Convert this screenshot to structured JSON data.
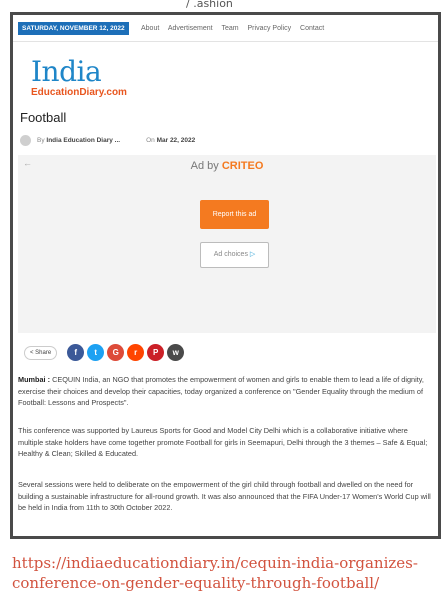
{
  "cutoff_text": "/ .ashion",
  "topbar": {
    "date": "SATURDAY, NOVEMBER 12, 2022",
    "nav": [
      "About",
      "Advertisement",
      "Team",
      "Privacy Policy",
      "Contact"
    ]
  },
  "logo": {
    "main": "India",
    "sub": "EducationDiary.com"
  },
  "article": {
    "title": "Football",
    "by_prefix": "By",
    "author": "India Education Diary ...",
    "on_prefix": "On",
    "date": "Mar 22, 2022"
  },
  "ad": {
    "back": "←",
    "ad_by": "Ad by",
    "brand": "CRITEO",
    "report_label": "Report this ad",
    "choices_label": "Ad choices",
    "choices_icon": "▷"
  },
  "share": {
    "label": "< Share",
    "buttons": [
      {
        "name": "facebook-icon",
        "glyph": "f",
        "color": "#3b5998"
      },
      {
        "name": "twitter-icon",
        "glyph": "t",
        "color": "#1da1f2"
      },
      {
        "name": "google-icon",
        "glyph": "G",
        "color": "#dd4b39"
      },
      {
        "name": "reddit-icon",
        "glyph": "r",
        "color": "#ff4500"
      },
      {
        "name": "pinterest-icon",
        "glyph": "P",
        "color": "#cb2027"
      },
      {
        "name": "whatsapp-icon",
        "glyph": "w",
        "color": "#4a4a4a"
      }
    ]
  },
  "paragraphs": {
    "p1_lead": "Mumbai :",
    "p1": "CEQUIN India, an NGO that promotes the empowerment of women and girls to enable them to lead a life of dignity, exercise their choices and develop their capacities, today organized a conference on \"Gender Equality through the medium of Football: Lessons and Prospects\".",
    "p2": "This conference was supported by Laureus Sports for Good and Model City Delhi which is a collaborative initiative where multiple stake holders have come together promote Football for girls in Seemapuri, Delhi through the 3 themes – Safe & Equal; Healthy & Clean; Skilled & Educated.",
    "p3": "Several sessions were held to deliberate on the empowerment of the girl child through football and dwelled on the need for building a sustainable infrastructure for all-round growth. It was also announced that the FIFA Under-17 Women's World Cup will be held in India from 11th to 30th October 2022."
  },
  "url": "https://indiaeducationdiary.in/cequin-india-organizes-conference-on-gender-equality-through-football/"
}
